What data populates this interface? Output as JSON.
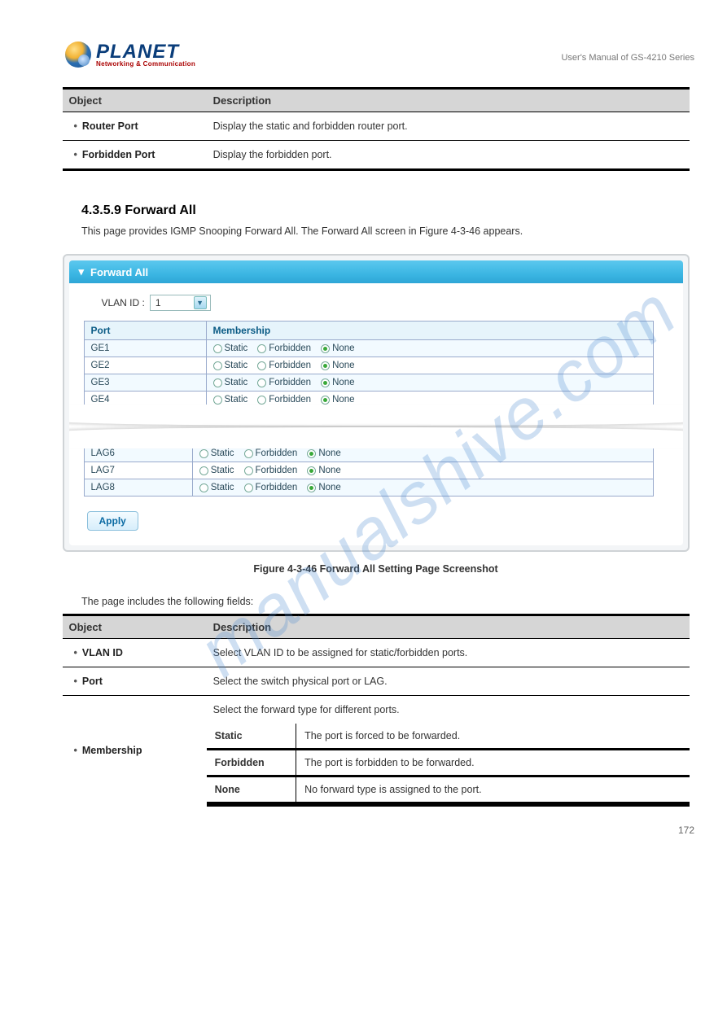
{
  "logo": {
    "brand": "PLANET",
    "tagline": "Networking & Communication"
  },
  "manual_title": "User's Manual of GS-4210 Series",
  "watermark": "manualshive.com",
  "table1": {
    "head_obj": "Object",
    "head_desc": "Description",
    "rows": [
      {
        "obj": "Router Port",
        "desc": "Display the static and forbidden router port."
      },
      {
        "obj": "Forbidden Port",
        "desc": "Display the forbidden port."
      }
    ]
  },
  "section": {
    "num": "4.3.5.9 Forward All",
    "desc_pre": "This page provides IGMP Snooping Forward All. The Forward All screen in ",
    "desc_fig_ref": "Figure 4-3-46",
    "desc_post": " appears."
  },
  "panel": {
    "title": "Forward All",
    "vlan_label": "VLAN ID :",
    "vlan_value": "1",
    "th_port": "Port",
    "th_membership": "Membership",
    "opt_static": "Static",
    "opt_forbidden": "Forbidden",
    "opt_none": "None",
    "rows_top": [
      "GE1",
      "GE2",
      "GE3",
      "GE4"
    ],
    "rows_bot": [
      "LAG6",
      "LAG7",
      "LAG8"
    ],
    "apply": "Apply"
  },
  "figure_caption": "Figure 4-3-46 Forward All Setting Page Screenshot",
  "subhead": "The page includes the following fields:",
  "table2": {
    "head_obj": "Object",
    "head_desc": "Description",
    "vlan": {
      "obj": "VLAN ID",
      "desc": "Select VLAN ID to be assigned for static/forbidden ports."
    },
    "port": {
      "obj": "Port",
      "desc": "Select the switch physical port or LAG."
    },
    "membership": {
      "obj": "Membership",
      "desc": "Select the forward type for different ports.",
      "options": [
        {
          "name": "Static",
          "text": "The port is forced to be forwarded."
        },
        {
          "name": "Forbidden",
          "text": "The port is forbidden to be forwarded."
        },
        {
          "name": "None",
          "text": "No forward type is assigned to the port."
        }
      ]
    }
  },
  "page_no": "172"
}
